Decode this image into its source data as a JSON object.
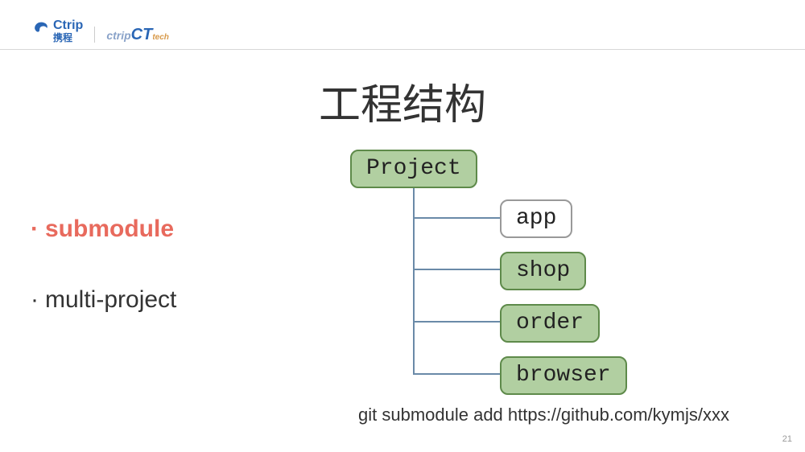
{
  "logo": {
    "brand_en": "Ctrip",
    "brand_cn": "携程",
    "sub_a": "ctrip",
    "sub_b": "CT",
    "sub_c": "tech"
  },
  "title": "工程结构",
  "bullets": {
    "item1": "submodule",
    "item2": "multi-project"
  },
  "tree": {
    "root": "Project",
    "children": {
      "c1": "app",
      "c2": "shop",
      "c3": "order",
      "c4": "browser"
    }
  },
  "command": "git submodule add https://github.com/kymjs/xxx",
  "page_number": "21"
}
